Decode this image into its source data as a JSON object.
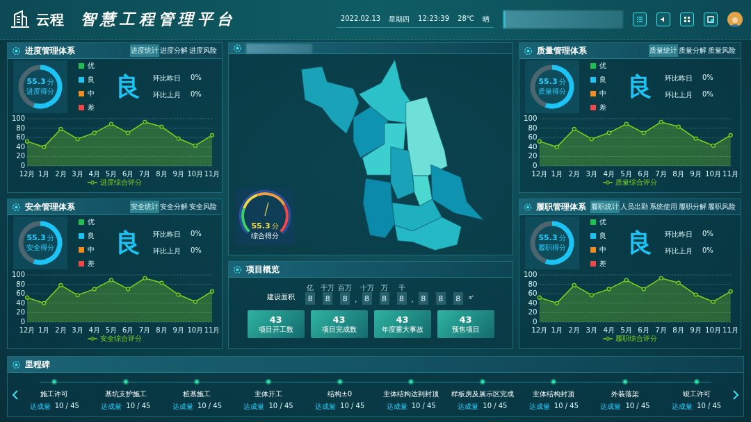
{
  "header": {
    "logo": "云程",
    "title": "智慧工程管理平台",
    "date": "2022.02.13",
    "weekday": "星期四",
    "time": "12:23:39",
    "temperature": "28℃",
    "weather": "晴"
  },
  "left_panels": [
    {
      "title": "进度管理体系",
      "tabs": [
        {
          "label": "进度统计",
          "selected": true
        },
        {
          "label": "进度分解",
          "selected": false
        },
        {
          "label": "进度风险",
          "selected": false
        }
      ],
      "score": {
        "value": "55.3",
        "unit": "分",
        "label": "进度得分",
        "level": 0.553
      },
      "legend": [
        {
          "label": "优",
          "color": "#1fbf4f"
        },
        {
          "label": "良",
          "color": "#1cc4f5"
        },
        {
          "label": "中",
          "color": "#f28c1c"
        },
        {
          "label": "差",
          "color": "#ef4848"
        }
      ],
      "grade": "良",
      "comparisons": [
        {
          "label": "环比昨日",
          "value": "0%"
        },
        {
          "label": "环比上月",
          "value": "0%"
        }
      ],
      "chart_data": {
        "type": "area",
        "grid": true,
        "categories": [
          "12月",
          "1月",
          "2月",
          "3月",
          "4月",
          "5月",
          "6月",
          "7月",
          "8月",
          "9月",
          "10月",
          "11月"
        ],
        "ylim": [
          0,
          100
        ],
        "yticks": [
          0,
          20,
          40,
          60,
          80,
          100
        ],
        "series": [
          {
            "name": "进度综合评分",
            "color": "#7ed321",
            "values": [
              52,
              40,
              78,
              57,
              70,
              89,
              70,
              93,
              83,
              58,
              43,
              65
            ]
          }
        ]
      }
    },
    {
      "title": "安全管理体系",
      "tabs": [
        {
          "label": "安全统计",
          "selected": true
        },
        {
          "label": "安全分解",
          "selected": false
        },
        {
          "label": "安全风险",
          "selected": false
        }
      ],
      "score": {
        "value": "55.3",
        "unit": "分",
        "label": "安全得分",
        "level": 0.553
      },
      "legend": [
        {
          "label": "优",
          "color": "#1fbf4f"
        },
        {
          "label": "良",
          "color": "#1cc4f5"
        },
        {
          "label": "中",
          "color": "#f28c1c"
        },
        {
          "label": "差",
          "color": "#ef4848"
        }
      ],
      "grade": "良",
      "comparisons": [
        {
          "label": "环比昨日",
          "value": "0%"
        },
        {
          "label": "环比上月",
          "value": "0%"
        }
      ],
      "chart_data": {
        "type": "area",
        "grid": true,
        "categories": [
          "12月",
          "1月",
          "2月",
          "3月",
          "4月",
          "5月",
          "6月",
          "7月",
          "8月",
          "9月",
          "10月",
          "11月"
        ],
        "ylim": [
          0,
          100
        ],
        "yticks": [
          0,
          20,
          40,
          60,
          80,
          100
        ],
        "series": [
          {
            "name": "安全综合评分",
            "color": "#7ed321",
            "values": [
              52,
              40,
              78,
              57,
              70,
              89,
              70,
              93,
              83,
              58,
              43,
              65
            ]
          }
        ]
      }
    }
  ],
  "map_panel": {
    "gauge": {
      "value": "55.3",
      "unit": "分",
      "label": "综合得分",
      "level": 0.553
    }
  },
  "overview": {
    "title": "项目概览",
    "area_label": "建设面积",
    "digits": [
      {
        "digit": "8",
        "unit": "亿"
      },
      {
        "digit": "8",
        "unit": "千万"
      },
      {
        "digit": "8",
        "unit": "百万"
      },
      {
        "kind": "sep",
        "digit": ","
      },
      {
        "digit": "8",
        "unit": "十万"
      },
      {
        "digit": "8",
        "unit": "万"
      },
      {
        "digit": "8",
        "unit": "千"
      },
      {
        "kind": "sep",
        "digit": ","
      },
      {
        "digit": "8"
      },
      {
        "digit": "8"
      },
      {
        "digit": "8"
      }
    ],
    "area_unit": "㎡",
    "stats": [
      {
        "value": "43",
        "label": "项目开工数"
      },
      {
        "value": "43",
        "label": "项目完成数"
      },
      {
        "value": "43",
        "label": "年度重大事故"
      },
      {
        "value": "43",
        "label": "预售项目"
      }
    ]
  },
  "right_panels": [
    {
      "title": "质量管理体系",
      "tabs": [
        {
          "label": "质量统计",
          "selected": true
        },
        {
          "label": "质量分解",
          "selected": false
        },
        {
          "label": "质量风险",
          "selected": false
        }
      ],
      "score": {
        "value": "55.3",
        "unit": "分",
        "label": "质量得分",
        "level": 0.553
      },
      "legend": [
        {
          "label": "优",
          "color": "#1fbf4f"
        },
        {
          "label": "良",
          "color": "#1cc4f5"
        },
        {
          "label": "中",
          "color": "#f28c1c"
        },
        {
          "label": "差",
          "color": "#ef4848"
        }
      ],
      "grade": "良",
      "comparisons": [
        {
          "label": "环比昨日",
          "value": "0%"
        },
        {
          "label": "环比上月",
          "value": "0%"
        }
      ],
      "chart_data": {
        "type": "area",
        "grid": true,
        "categories": [
          "12月",
          "1月",
          "2月",
          "3月",
          "4月",
          "5月",
          "6月",
          "7月",
          "8月",
          "9月",
          "10月",
          "11月"
        ],
        "ylim": [
          0,
          100
        ],
        "yticks": [
          0,
          20,
          40,
          60,
          80,
          100
        ],
        "series": [
          {
            "name": "质量综合评分",
            "color": "#7ed321",
            "values": [
              52,
              40,
              78,
              57,
              70,
              89,
              70,
              93,
              83,
              58,
              43,
              65
            ]
          }
        ]
      }
    },
    {
      "title": "履职管理体系",
      "tabs": [
        {
          "label": "履职统计",
          "selected": true
        },
        {
          "label": "人员出勤",
          "selected": false
        },
        {
          "label": "系统使用",
          "selected": false
        },
        {
          "label": "履职分解",
          "selected": false
        },
        {
          "label": "履职风险",
          "selected": false
        }
      ],
      "score": {
        "value": "55.3",
        "unit": "分",
        "label": "履职得分",
        "level": 0.553
      },
      "legend": [
        {
          "label": "优",
          "color": "#1fbf4f"
        },
        {
          "label": "良",
          "color": "#1cc4f5"
        },
        {
          "label": "中",
          "color": "#f28c1c"
        },
        {
          "label": "差",
          "color": "#ef4848"
        }
      ],
      "grade": "良",
      "comparisons": [
        {
          "label": "环比昨日",
          "value": "0%"
        },
        {
          "label": "环比上月",
          "value": "0%"
        }
      ],
      "chart_data": {
        "type": "area",
        "grid": true,
        "categories": [
          "12月",
          "1月",
          "2月",
          "3月",
          "4月",
          "5月",
          "6月",
          "7月",
          "8月",
          "9月",
          "10月",
          "11月"
        ],
        "ylim": [
          0,
          100
        ],
        "yticks": [
          0,
          20,
          40,
          60,
          80,
          100
        ],
        "series": [
          {
            "name": "履职综合评分",
            "color": "#7ed321",
            "values": [
              52,
              40,
              78,
              57,
              70,
              89,
              70,
              93,
              83,
              58,
              43,
              65
            ]
          }
        ]
      }
    }
  ],
  "milestones": {
    "title": "里程碑",
    "items": [
      {
        "name": "施工许可",
        "label": "达成量",
        "value": "10 / 45"
      },
      {
        "name": "基坑支护施工",
        "label": "达成量",
        "value": "10 / 45"
      },
      {
        "name": "桩基施工",
        "label": "达成量",
        "value": "10 / 45"
      },
      {
        "name": "主体开工",
        "label": "达成量",
        "value": "10 / 45"
      },
      {
        "name": "结构±0",
        "label": "达成量",
        "value": "10 / 45"
      },
      {
        "name": "主体结构达到封顶",
        "label": "达成量",
        "value": "10 / 45"
      },
      {
        "name": "样板房及展示区完成",
        "label": "达成量",
        "value": "10 / 45"
      },
      {
        "name": "主体结构封顶",
        "label": "达成量",
        "value": "10 / 45"
      },
      {
        "name": "外装落架",
        "label": "达成量",
        "value": "10 / 45"
      },
      {
        "name": "竣工许可",
        "label": "达成量",
        "value": "10 / 45"
      }
    ]
  }
}
